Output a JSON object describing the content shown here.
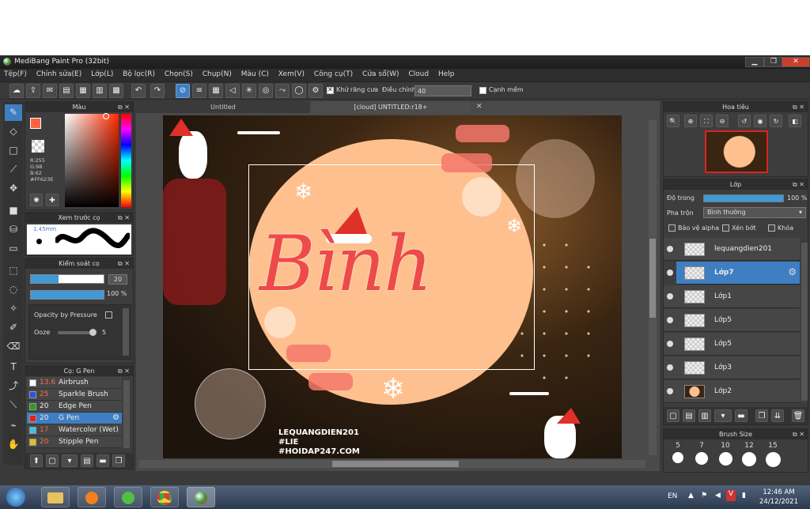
{
  "window": {
    "title": "MediBang Paint Pro (32bit)",
    "min_label": "▁",
    "max_label": "❐",
    "close_label": "✕"
  },
  "menu": [
    "Tệp(F)",
    "Chỉnh sửa(E)",
    "Lớp(L)",
    "Bộ lọc(R)",
    "Chọn(S)",
    "Chụp(N)",
    "Màu (C)",
    "Xem(V)",
    "Công cụ(T)",
    "Cửa sổ(W)",
    "Cloud",
    "Help"
  ],
  "toolbar": {
    "antialias_label": "Khử răng cưa",
    "adjust_label": "Điều chỉnh",
    "adjust_value": "40",
    "smooth_label": "Cạnh mềm"
  },
  "color_panel": {
    "title": "Màu",
    "r": "R:255",
    "g": "G:98",
    "b": "B:62",
    "hex": "#FF623E",
    "fg_color": "#ff623e"
  },
  "brush_preview": {
    "title": "Xem trước cọ",
    "size": "1.45mm"
  },
  "brush_control": {
    "title": "Kiểm soát cọ",
    "size_value": "20",
    "opacity_value": "100 %",
    "pressure_label": "Opacity by Pressure",
    "ooze_label": "Ooze",
    "ooze_value": "5"
  },
  "brush_list": {
    "title": "Cọ: G Pen",
    "items": [
      {
        "size": "13.6",
        "name": "Airbrush",
        "color": "#ffffff"
      },
      {
        "size": "25",
        "name": "Sparkle Brush",
        "color": "#3050e0"
      },
      {
        "size": "20",
        "name": "Edge Pen",
        "color": "#20a020"
      },
      {
        "size": "20",
        "name": "G Pen",
        "color": "#e02020"
      },
      {
        "size": "17",
        "name": "Watercolor (Wet)",
        "color": "#40c0e0"
      },
      {
        "size": "20",
        "name": "Stipple Pen",
        "color": "#e0c020"
      }
    ]
  },
  "tabs": [
    "Untitled",
    "[cloud] UNTITLED:r18+"
  ],
  "artwork": {
    "lettering": "Bình",
    "credit1": "LEQUANGDIEN201",
    "credit2": "#LIE",
    "credit3": "#HOIDAP247.COM"
  },
  "navigator": {
    "title": "Hoa tiêu"
  },
  "layer_panel": {
    "title": "Lớp",
    "opacity_label": "Độ trong",
    "opacity_value": "100 %",
    "blend_label": "Pha trộn",
    "blend_value": "Bình thường",
    "protect_alpha": "Bảo vệ alpha",
    "clipping": "Xén bớt",
    "lock": "Khóa",
    "layers": [
      {
        "name": "lequangdien201",
        "selected": false
      },
      {
        "name": "Lớp7",
        "selected": true
      },
      {
        "name": "Lớp1",
        "selected": false
      },
      {
        "name": "Lớp5",
        "selected": false
      },
      {
        "name": "Lớp5",
        "selected": false
      },
      {
        "name": "Lớp3",
        "selected": false
      },
      {
        "name": "Lớp2",
        "selected": false
      }
    ]
  },
  "brush_size": {
    "title": "Brush Size",
    "sizes": [
      "5",
      "7",
      "10",
      "12",
      "15"
    ]
  },
  "taskbar": {
    "lang": "EN",
    "time": "12:46 AM",
    "date": "24/12/2021"
  }
}
